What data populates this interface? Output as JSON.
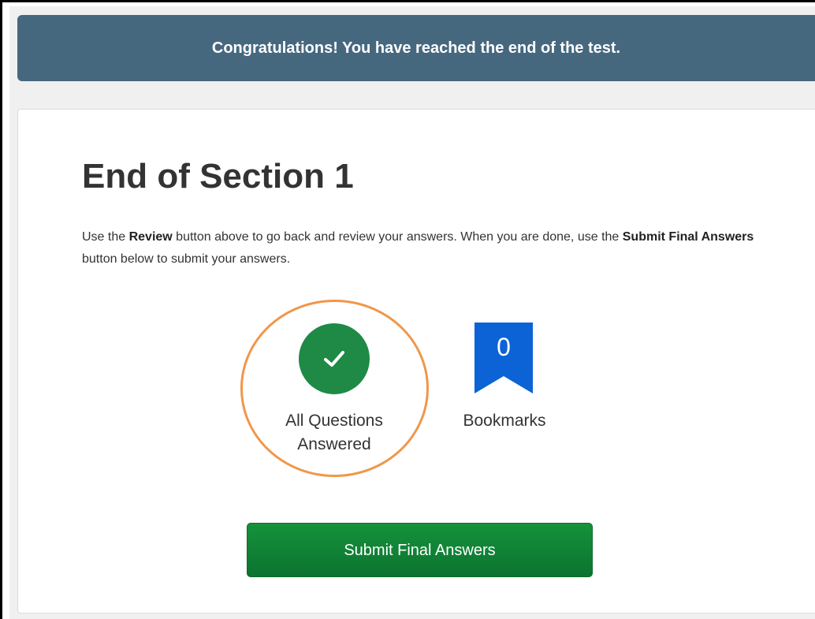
{
  "banner": {
    "message": "Congratulations! You have reached the end of the test."
  },
  "section": {
    "title": "End of Section 1",
    "instructions": {
      "part1": "Use the ",
      "review_bold": "Review",
      "part2": " button above to go back and review your answers. When you are done, use the ",
      "submit_bold": "Submit Final Answers",
      "part3": " button below to submit your answers."
    }
  },
  "status": {
    "answered_label": "All Questions Answered",
    "answered_icon": "check-icon",
    "answered_color": "#1e8a45",
    "bookmarks_count": "0",
    "bookmarks_label": "Bookmarks",
    "bookmarks_icon": "bookmark-icon",
    "bookmarks_color": "#0b63d6"
  },
  "highlight": {
    "color": "#f0974a"
  },
  "actions": {
    "submit_label": "Submit Final Answers",
    "submit_color": "#0f7d34"
  },
  "colors": {
    "banner": "#46687f",
    "text": "#333333"
  }
}
